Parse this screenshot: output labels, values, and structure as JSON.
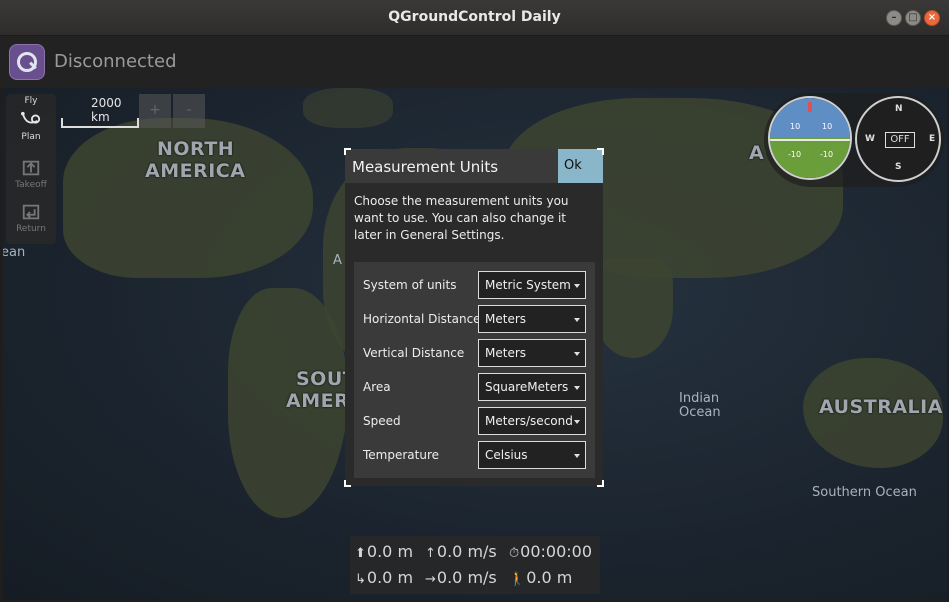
{
  "window": {
    "title": "QGroundControl Daily",
    "buttons": [
      "–",
      "□",
      "×"
    ]
  },
  "toolbar": {
    "status": "Disconnected"
  },
  "map": {
    "scale_label": "2000 km",
    "zoom_in": "+",
    "zoom_out": "-",
    "labels": {
      "north_america_1": "NORTH",
      "north_america_2": "AMERICA",
      "south_america_1": "SOUT",
      "south_america_2": "AMER",
      "australia": "AUSTRALIA",
      "asia_partial": "A",
      "africa_partial": "A",
      "indian_ocean_1": "Indian",
      "indian_ocean_2": "Ocean",
      "southern_ocean": "Southern Ocean",
      "ocean_left": "ean"
    }
  },
  "toolstrip": {
    "items": [
      {
        "label": "Fly",
        "icon": "fly-icon"
      },
      {
        "label": "Plan",
        "icon": "plan-icon"
      },
      {
        "label": "Takeoff",
        "icon": "takeoff-icon"
      },
      {
        "label": "Return",
        "icon": "return-icon"
      }
    ]
  },
  "instruments": {
    "pitch_labels": [
      "10",
      "10",
      "-10",
      "-10"
    ],
    "compass": {
      "n": "N",
      "e": "E",
      "s": "S",
      "w": "W",
      "off": "OFF"
    }
  },
  "dialog": {
    "title": "Measurement Units",
    "ok_label": "Ok",
    "description": "Choose the measurement units you want to use. You can also change it later in General Settings.",
    "rows": [
      {
        "label": "System of units",
        "value": "Metric System"
      },
      {
        "label": "Horizontal Distance",
        "value": "Meters"
      },
      {
        "label": "Vertical Distance",
        "value": "Meters"
      },
      {
        "label": "Area",
        "value": "SquareMeters"
      },
      {
        "label": "Speed",
        "value": "Meters/second"
      },
      {
        "label": "Temperature",
        "value": "Celsius"
      }
    ]
  },
  "telemetry": {
    "altitude_rel": "0.0 m",
    "vertical_speed": "0.0 m/s",
    "flight_time": "00:00:00",
    "distance_home": "0.0 m",
    "ground_speed": "0.0 m/s",
    "distance_walk": "0.0 m"
  },
  "colors": {
    "ok_button": "#89b6c8",
    "dialog_bg": "#2a2a2a",
    "toolbar_bg": "#222222",
    "status_text": "#9a9a9a"
  }
}
